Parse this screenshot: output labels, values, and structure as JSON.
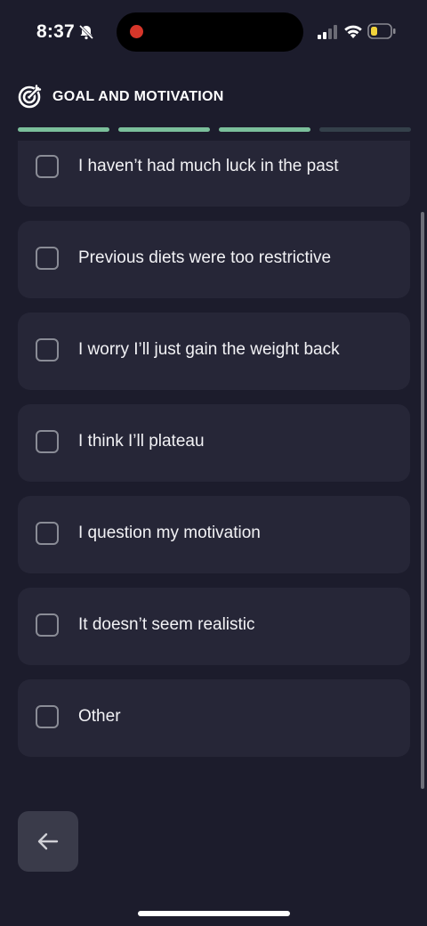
{
  "status_bar": {
    "time": "8:37",
    "icons": [
      "bell-slash-icon",
      "recording-dot-icon",
      "cellular-signal-icon",
      "wifi-icon",
      "battery-low-icon"
    ]
  },
  "header": {
    "icon": "target-icon",
    "title": "GOAL AND MOTIVATION"
  },
  "progress": {
    "segments_total": 4,
    "segments_completed": 3,
    "active_color": "#7bbf9b",
    "inactive_color": "#34404a"
  },
  "options": [
    {
      "label": "I haven’t had much luck in the past",
      "checked": false
    },
    {
      "label": "Previous diets were too restrictive",
      "checked": false
    },
    {
      "label": "I worry I’ll just gain the weight back",
      "checked": false
    },
    {
      "label": "I think I’ll plateau",
      "checked": false
    },
    {
      "label": "I question my motivation",
      "checked": false
    },
    {
      "label": "It doesn’t seem realistic",
      "checked": false
    },
    {
      "label": "Other",
      "checked": false
    }
  ],
  "back_button": {
    "icon": "arrow-left-icon"
  },
  "colors": {
    "background": "#1c1c2c",
    "card": "#262637",
    "accent": "#7bbf9b"
  }
}
